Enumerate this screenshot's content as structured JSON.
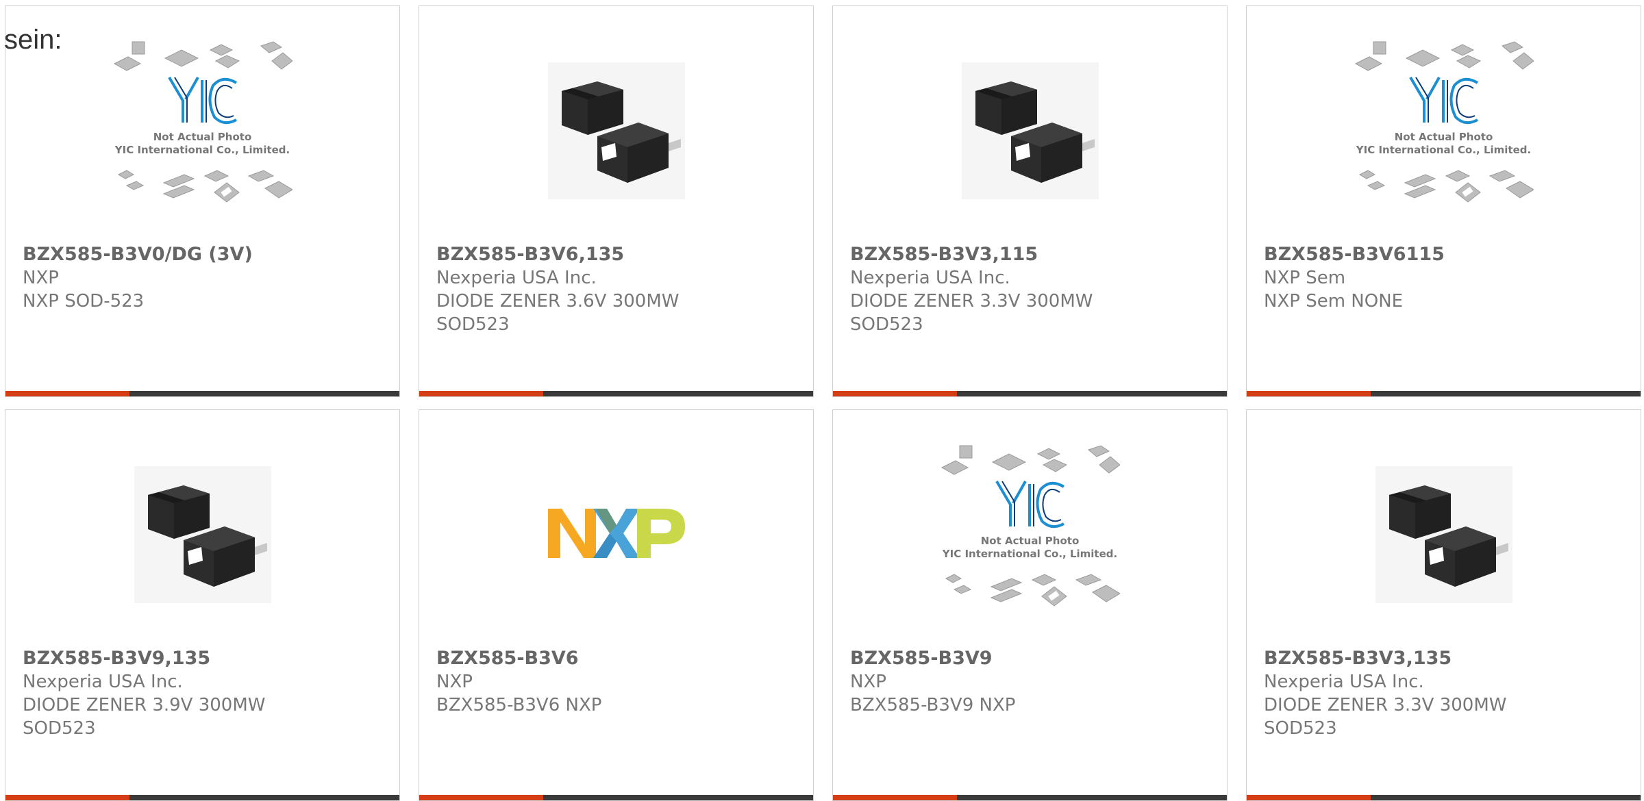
{
  "intro_text": "sein:",
  "placeholder": {
    "brand": "YIC",
    "caption1": "Not Actual Photo",
    "caption2": "YIC International Co., Limited."
  },
  "nxp_logo": {
    "text": "NXP",
    "colors": [
      "#f7a823",
      "#9ac33c",
      "#1c9fdd",
      "#c9d848"
    ]
  },
  "accent_color": "#d53d15",
  "bar_color": "#3a3a3a",
  "products": [
    {
      "image": "yic-placeholder",
      "part": "BZX585-B3V0/DG (3V)",
      "lines": [
        "NXP",
        "NXP SOD-523"
      ]
    },
    {
      "image": "diode-photo",
      "part": "BZX585-B3V6,135",
      "lines": [
        "Nexperia USA Inc.",
        "DIODE ZENER 3.6V 300MW",
        "SOD523"
      ]
    },
    {
      "image": "diode-photo",
      "part": "BZX585-B3V3,115",
      "lines": [
        "Nexperia USA Inc.",
        "DIODE ZENER 3.3V 300MW",
        "SOD523"
      ]
    },
    {
      "image": "yic-placeholder",
      "part": "BZX585-B3V6115",
      "lines": [
        "NXP Sem",
        "NXP Sem NONE"
      ]
    },
    {
      "image": "diode-photo",
      "part": "BZX585-B3V9,135",
      "lines": [
        "Nexperia USA Inc.",
        "DIODE ZENER 3.9V 300MW",
        "SOD523"
      ]
    },
    {
      "image": "nxp-logo",
      "part": "BZX585-B3V6",
      "lines": [
        "NXP",
        "BZX585-B3V6 NXP"
      ]
    },
    {
      "image": "yic-placeholder",
      "part": "BZX585-B3V9",
      "lines": [
        "NXP",
        "BZX585-B3V9 NXP"
      ]
    },
    {
      "image": "diode-photo",
      "part": "BZX585-B3V3,135",
      "lines": [
        "Nexperia USA Inc.",
        "DIODE ZENER 3.3V 300MW",
        "SOD523"
      ]
    }
  ]
}
